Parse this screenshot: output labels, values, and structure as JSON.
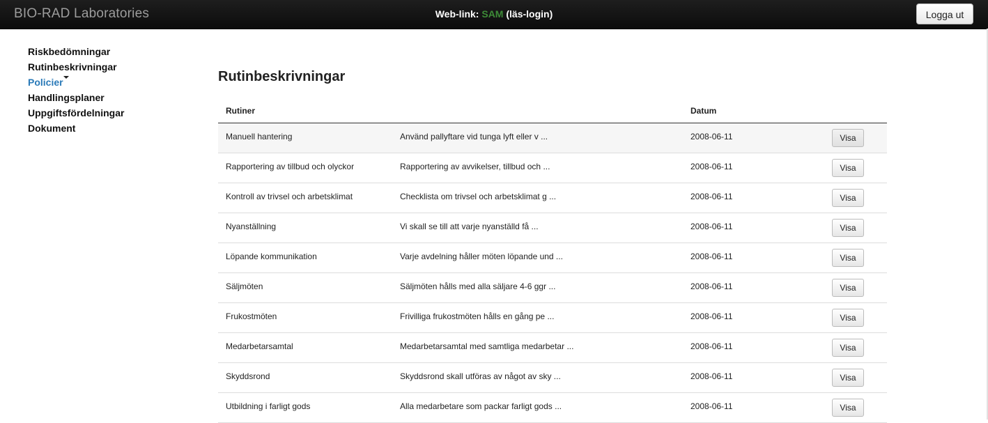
{
  "header": {
    "brand": "BIO-RAD Laboratories",
    "weblink_prefix": "Web-link:",
    "weblink_user": "SAM",
    "weblink_suffix": "(läs-login)",
    "logout_label": "Logga ut"
  },
  "sidebar": {
    "items": [
      {
        "label": "Riskbedömningar"
      },
      {
        "label": "Rutinbeskrivningar"
      },
      {
        "label": "Policier"
      },
      {
        "label": "Handlingsplaner"
      },
      {
        "label": "Uppgiftsfördelningar"
      },
      {
        "label": "Dokument"
      }
    ]
  },
  "main": {
    "title": "Rutinbeskrivningar",
    "columns": {
      "rutiner": "Rutiner",
      "datum": "Datum"
    },
    "view_label": "Visa",
    "rows": [
      {
        "name": "Manuell hantering",
        "desc": "Använd pallyftare vid tunga lyft eller v ...",
        "date": "2008-06-11"
      },
      {
        "name": "Rapportering av tillbud och olyckor",
        "desc": "Rapportering av avvikelser, tillbud och ...",
        "date": "2008-06-11"
      },
      {
        "name": "Kontroll av trivsel och arbetsklimat",
        "desc": "Checklista om trivsel och arbetsklimat g ...",
        "date": "2008-06-11"
      },
      {
        "name": "Nyanställning",
        "desc": "Vi skall se till att varje nyanställd få ...",
        "date": "2008-06-11"
      },
      {
        "name": "Löpande kommunikation",
        "desc": "Varje avdelning håller möten löpande und ...",
        "date": "2008-06-11"
      },
      {
        "name": "Säljmöten",
        "desc": "Säljmöten hålls med alla säljare 4-6 ggr ...",
        "date": "2008-06-11"
      },
      {
        "name": "Frukostmöten",
        "desc": "Frivilliga frukostmöten hålls en gång pe ...",
        "date": "2008-06-11"
      },
      {
        "name": "Medarbetarsamtal",
        "desc": "Medarbetarsamtal med samtliga medarbetar ...",
        "date": "2008-06-11"
      },
      {
        "name": "Skyddsrond",
        "desc": "Skyddsrond skall utföras av något av sky ...",
        "date": "2008-06-11"
      },
      {
        "name": "Utbildning i farligt gods",
        "desc": "Alla medarbetare som packar farligt gods ...",
        "date": "2008-06-11"
      }
    ]
  }
}
